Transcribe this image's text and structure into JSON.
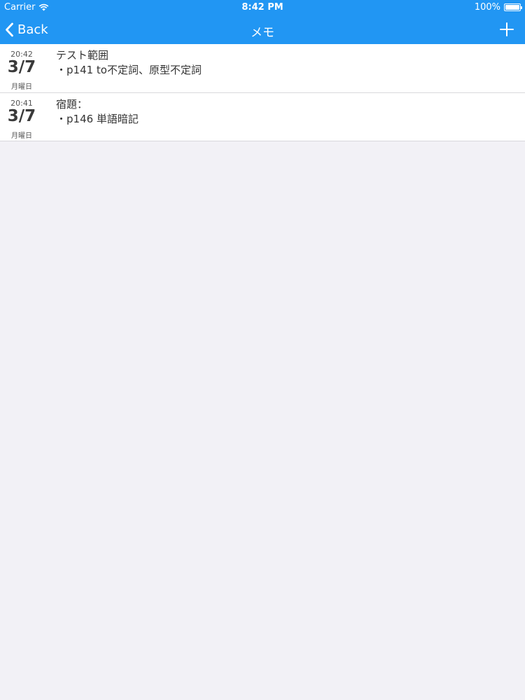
{
  "status": {
    "carrier": "Carrier",
    "time": "8:42 PM",
    "battery": "100%"
  },
  "nav": {
    "back_label": "Back",
    "title": "メモ"
  },
  "memos": [
    {
      "time": "20:42",
      "date": "3/7",
      "weekday": "月曜日",
      "line1": "テスト範囲",
      "line2": "・p141 to不定詞、原型不定詞"
    },
    {
      "time": "20:41",
      "date": "3/7",
      "weekday": "月曜日",
      "line1": "宿題：",
      "line2": "・p146 単語暗記"
    }
  ],
  "colors": {
    "nav_bar": "#2196f3",
    "background": "#f2f1f6"
  }
}
